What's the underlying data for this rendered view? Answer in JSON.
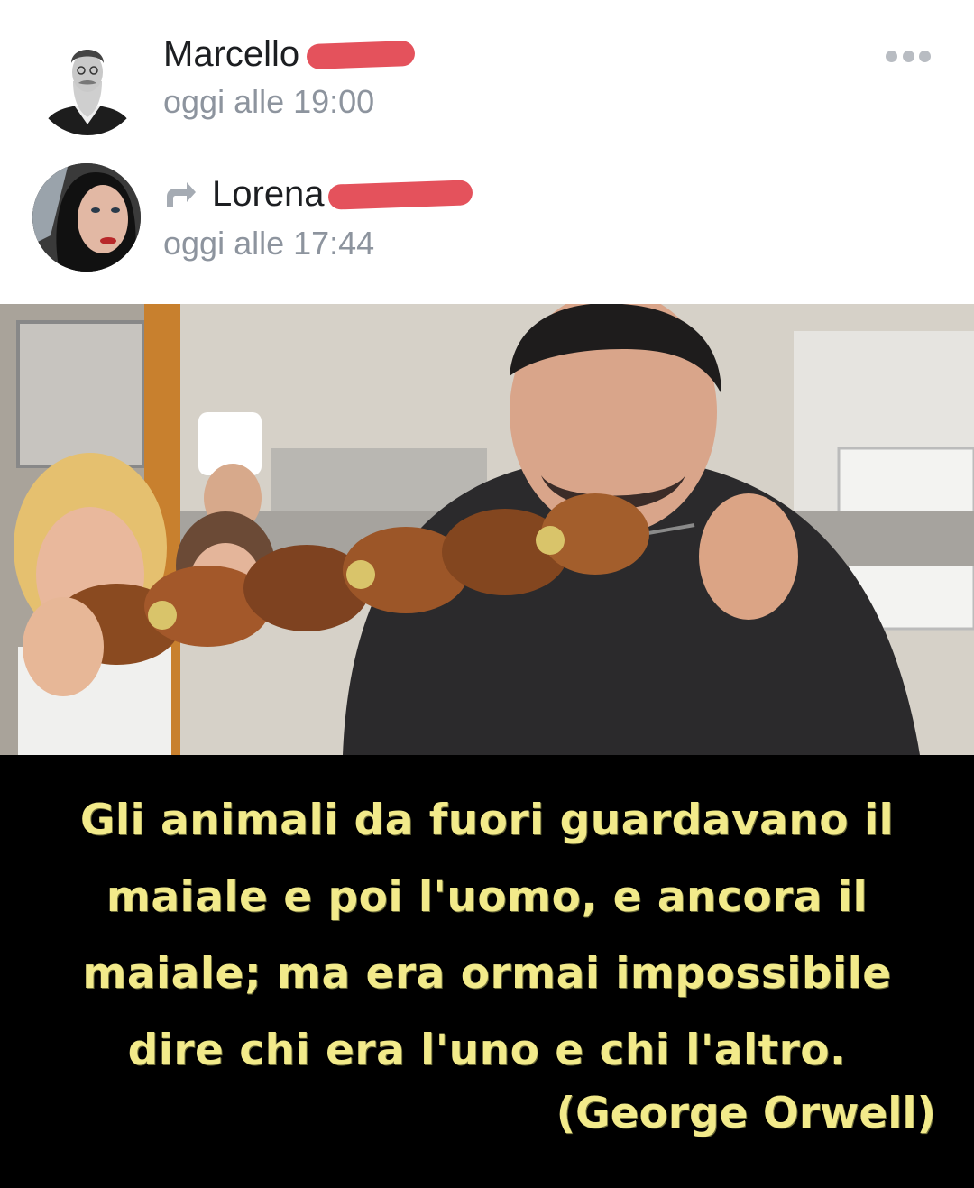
{
  "author": {
    "name": "Marcello",
    "timestamp": "oggi alle 19:00"
  },
  "shared_from": {
    "name": "Lorena",
    "timestamp": "oggi alle 17:44",
    "icon": "share-arrow-icon"
  },
  "menu": {
    "icon": "more-options-icon"
  },
  "image_caption": {
    "lines": [
      "Gli animali da fuori guardavano il",
      "maiale e poi l'uomo, e ancora il",
      "maiale; ma era ormai impossibile",
      "dire chi era l'uno e chi l'altro."
    ],
    "attribution": "(George Orwell)"
  },
  "colors": {
    "redaction": "#e4525c",
    "caption_text": "#f2ea8a",
    "timestamp": "#8d949e"
  }
}
